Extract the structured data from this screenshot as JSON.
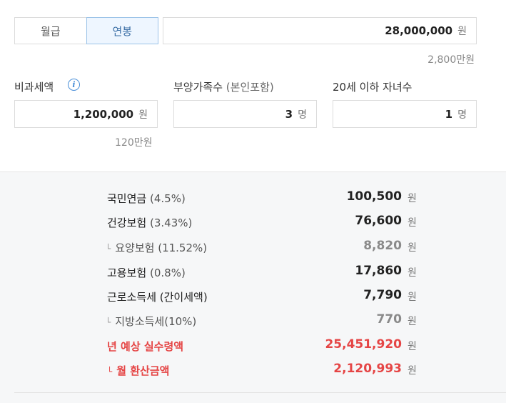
{
  "period_toggle": {
    "monthly_label": "월급",
    "annual_label": "연봉",
    "selected": "연봉"
  },
  "salary": {
    "value": "28,000,000",
    "unit": "원",
    "note": "2,800만원"
  },
  "nontax": {
    "label": "비과세액",
    "value": "1,200,000",
    "unit": "원",
    "note": "120만원",
    "info_icon": "info-icon"
  },
  "dependents": {
    "label": "부양가족수",
    "label_paren": "(본인포함)",
    "value": "3",
    "unit": "명"
  },
  "children": {
    "label": "20세 이하 자녀수",
    "value": "1",
    "unit": "명"
  },
  "results": [
    {
      "label": "국민연금",
      "pct": "(4.5%)",
      "amount": "100,500",
      "unit": "원"
    },
    {
      "label": "건강보험",
      "pct": "(3.43%)",
      "amount": "76,600",
      "unit": "원"
    },
    {
      "branch": "└",
      "label": "요양보험",
      "pct": "(11.52%)",
      "amount": "8,820",
      "unit": "원"
    },
    {
      "label": "고용보험",
      "pct": "(0.8%)",
      "amount": "17,860",
      "unit": "원"
    },
    {
      "label": "근로소득세 (간이세액)",
      "amount": "7,790",
      "unit": "원"
    },
    {
      "branch": "└",
      "label": "지방소득세(10%)",
      "amount": "770",
      "unit": "원"
    },
    {
      "label": "년 예상 실수령액",
      "amount": "25,451,920",
      "unit": "원"
    },
    {
      "branch": "└",
      "label": "월 환산금액",
      "amount": "2,120,993",
      "unit": "원"
    }
  ],
  "colors": {
    "accent_blue": "#4a8fd8",
    "highlight_red": "#e54545",
    "result_bg": "#f6f7f8"
  }
}
